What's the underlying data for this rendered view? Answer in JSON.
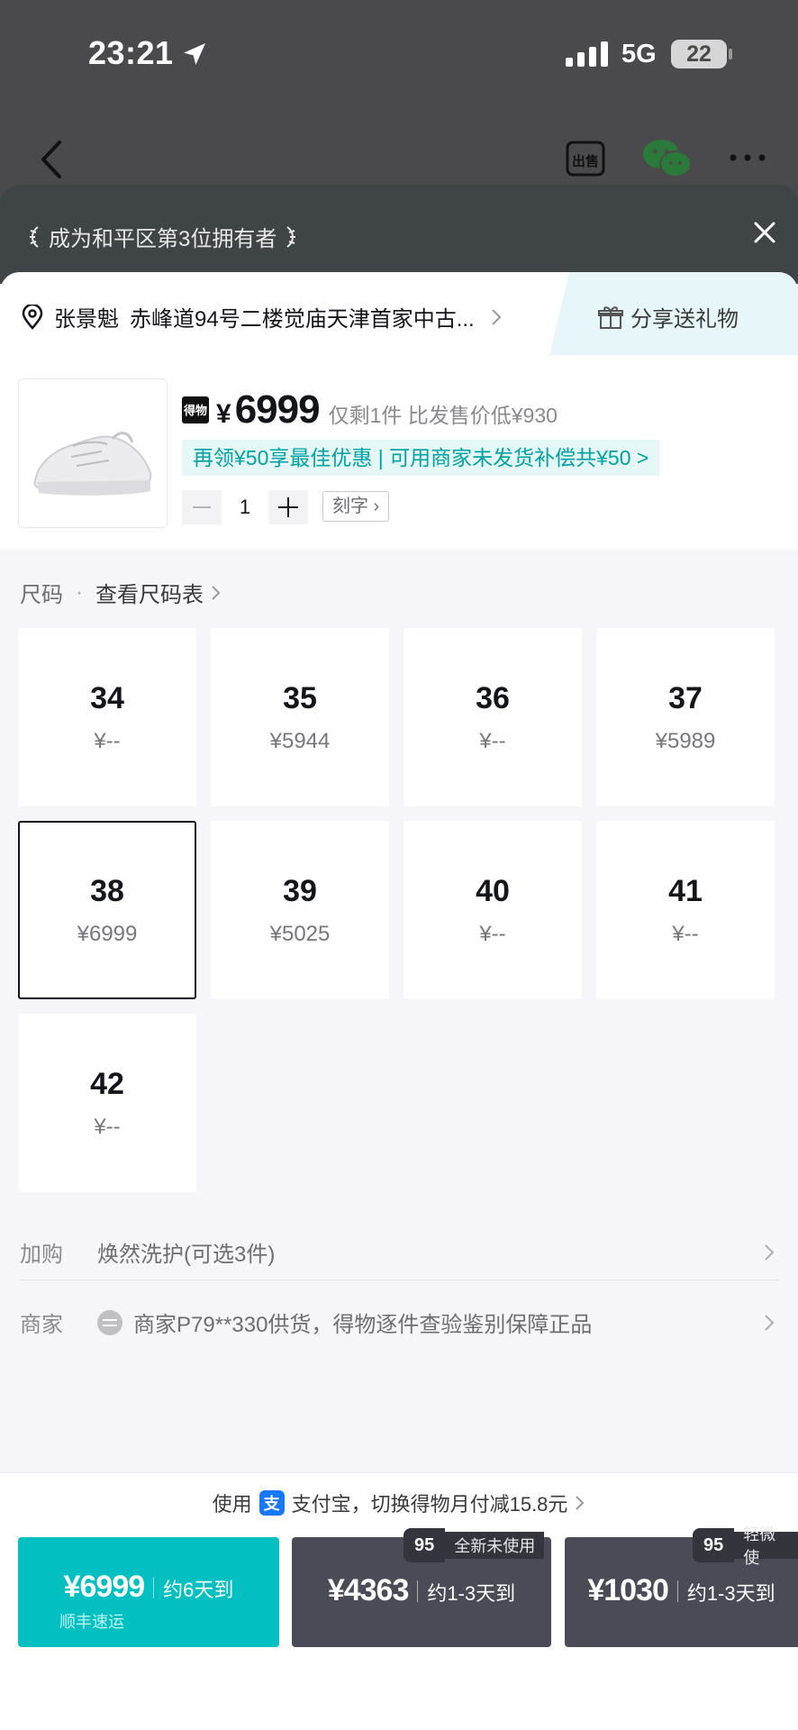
{
  "status_bar": {
    "time": "23:21",
    "network": "5G",
    "battery": "22"
  },
  "nav": {
    "sell_label": "出售"
  },
  "banner": {
    "text": "成为和平区第3位拥有者"
  },
  "address": {
    "name": "张景魁",
    "detail": "赤峰道94号二楼觉庙天津首家中古..."
  },
  "gift": {
    "label": "分享送礼物"
  },
  "product": {
    "badge": "得物",
    "currency": "¥",
    "price": "6999",
    "note": "仅剩1件 比发售价低¥930",
    "promo": "再领¥50享最佳优惠 | 可用商家未发货补偿共¥50 >",
    "quantity": "1",
    "engrave_label": "刻字"
  },
  "size_section": {
    "label": "尺码",
    "chart_link": "查看尺码表"
  },
  "sizes": [
    {
      "size": "34",
      "price": "¥--"
    },
    {
      "size": "35",
      "price": "¥5944"
    },
    {
      "size": "36",
      "price": "¥--"
    },
    {
      "size": "37",
      "price": "¥5989"
    },
    {
      "size": "38",
      "price": "¥6999",
      "selected": true
    },
    {
      "size": "39",
      "price": "¥5025"
    },
    {
      "size": "40",
      "price": "¥--"
    },
    {
      "size": "41",
      "price": "¥--"
    },
    {
      "size": "42",
      "price": "¥--"
    }
  ],
  "addon": {
    "key": "加购",
    "value": "焕然洗护(可选3件)"
  },
  "merchant": {
    "key": "商家",
    "value": "商家P79**330供货，得物逐件查验鉴别保障正品"
  },
  "payment": {
    "prefix": "使用",
    "icon": "支",
    "text": "支付宝，切换得物月付减15.8元"
  },
  "buy_options": [
    {
      "price": "¥6999",
      "eta": "约6天到",
      "sub": "顺丰速运"
    },
    {
      "price": "¥4363",
      "eta": "约1-3天到",
      "grade": "95",
      "tag": "全新未使用"
    },
    {
      "price": "¥1030",
      "eta": "约1-3天到",
      "grade": "95",
      "tag": "轻微使"
    }
  ]
}
